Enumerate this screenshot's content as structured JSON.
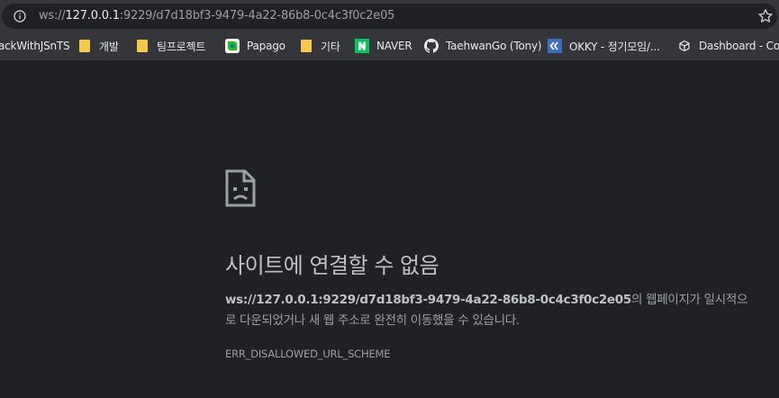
{
  "address_bar": {
    "scheme": "ws://",
    "host": "127.0.0.1",
    "rest": ":9229/d7d18bf3-9479-4a22-86b8-0c4c3f0c2e05"
  },
  "bookmarks": [
    {
      "label": "ackWithJSnTS",
      "icon": "none"
    },
    {
      "label": "개발",
      "icon": "folder-icon"
    },
    {
      "label": "팀프로젝트",
      "icon": "folder-icon"
    },
    {
      "label": "Papago",
      "icon": "papago-icon"
    },
    {
      "label": "기타",
      "icon": "folder-icon"
    },
    {
      "label": "NAVER",
      "icon": "naver-icon"
    },
    {
      "label": "TaehwanGo (Tony)",
      "icon": "github-icon"
    },
    {
      "label": "OKKY - 정기모임/...",
      "icon": "okky-icon"
    },
    {
      "label": "Dashboard - Cod",
      "icon": "codesandbox-icon"
    }
  ],
  "error": {
    "icon": "sad-page-icon",
    "title": "사이트에 연결할 수 없음",
    "url": "ws://127.0.0.1:9229/d7d18bf3-9479-4a22-86b8-0c4c3f0c2e05",
    "desc_line1_suffix": "의 웹페이지가 일시적으",
    "desc_line2": "로 다운되었거나 새 웹 주소로 완전히 이동했을 수 있습니다.",
    "code": "ERR_DISALLOWED_URL_SCHEME"
  },
  "colors": {
    "toolbar_bg": "#35363a",
    "page_bg": "#202124",
    "title_text": "#bdc1c6",
    "body_text": "#9aa0a6"
  }
}
